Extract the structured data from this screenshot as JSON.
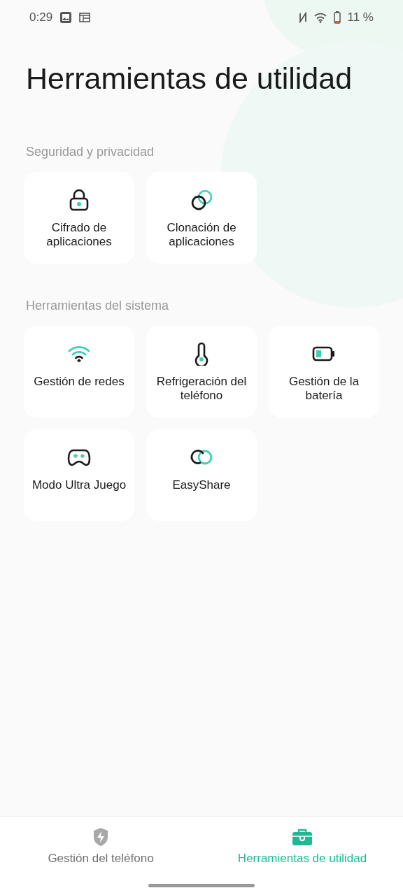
{
  "status_bar": {
    "time": "0:29",
    "battery_text": "11 %"
  },
  "title": "Herramientas de utilidad",
  "sections": [
    {
      "heading": "Seguridad y privacidad",
      "tools": [
        {
          "label": "Cifrado de aplicaciones",
          "kind": "lock"
        },
        {
          "label": "Clonación de aplicaciones",
          "kind": "clone"
        }
      ]
    },
    {
      "heading": "Herramientas del sistema",
      "tools": [
        {
          "label": "Gestión de redes",
          "kind": "wifi"
        },
        {
          "label": "Refrigeración del teléfono",
          "kind": "thermometer"
        },
        {
          "label": "Gestión de la batería",
          "kind": "battery"
        },
        {
          "label": "Modo Ultra Juego",
          "kind": "gamepad"
        },
        {
          "label": "EasyShare",
          "kind": "link"
        }
      ]
    }
  ],
  "bottom_nav": [
    {
      "label": "Gestión del teléfono",
      "kind": "shield",
      "selected": false
    },
    {
      "label": "Herramientas de utilidad",
      "kind": "toolbox",
      "selected": true
    }
  ]
}
